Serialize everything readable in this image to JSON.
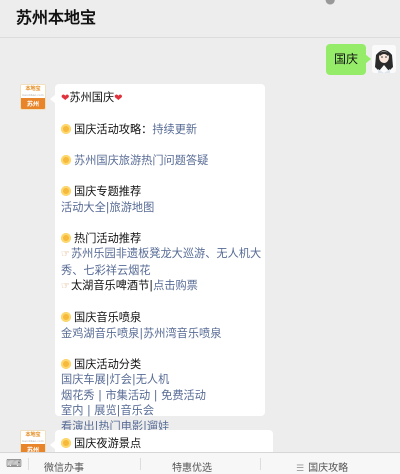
{
  "header": {
    "title": "苏州本地宝",
    "icons": [
      "person-icon",
      "more-icon"
    ]
  },
  "user_message": {
    "text": "国庆"
  },
  "bot": {
    "avatar_top": "本地宝",
    "avatar_sub": "bendibao.com",
    "avatar_bottom": "苏州"
  },
  "card": {
    "title": "苏州国庆",
    "strategy_label": "国庆活动攻略：",
    "strategy_link": "持续更新",
    "faq_link": "苏州国庆旅游热门问题答疑",
    "topic_heading": "国庆专题推荐",
    "topic_links": [
      "活动大全",
      "旅游地图"
    ],
    "hot_heading": "热门活动推荐",
    "hot_item1_line1": "苏州乐园非遗板凳龙大巡游、无人机大",
    "hot_item1_line2": "秀、七彩祥云烟花",
    "hot_item2_text": "太湖音乐啤酒节|",
    "hot_item2_link": "点击购票",
    "fountain_heading": "国庆音乐喷泉",
    "fountain_links": [
      "金鸡湖音乐喷泉",
      "苏州湾音乐喷泉"
    ],
    "category_heading": "国庆活动分类",
    "category_row1": [
      "国庆车展",
      "灯会",
      "无人机"
    ],
    "category_row2": [
      "烟花秀",
      "市集活动",
      "免费活动"
    ],
    "category_row3": [
      "室内",
      "展览",
      "音乐会"
    ],
    "category_row4": [
      "看演出",
      "热门电影",
      "遛娃"
    ],
    "sep": "|",
    "sep_spaced": " | "
  },
  "card2": {
    "heading": "国庆夜游景点"
  },
  "tabbar": {
    "tabs": [
      "微信办事",
      "特惠优选",
      "国庆攻略"
    ]
  }
}
